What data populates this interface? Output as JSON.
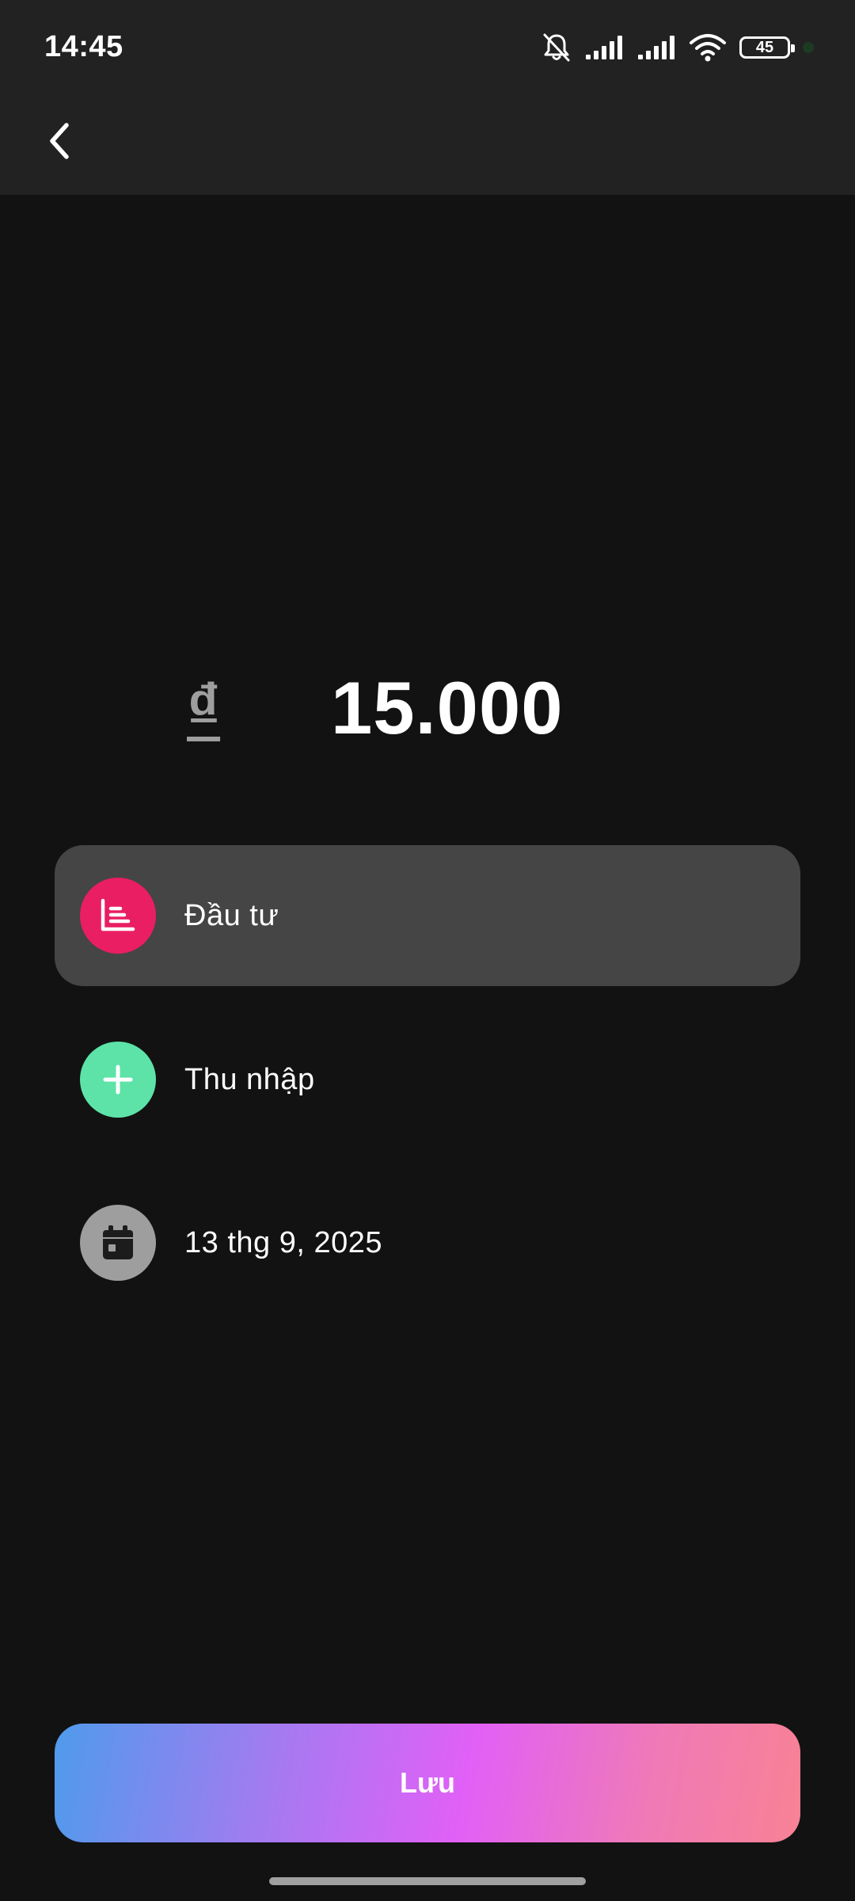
{
  "status_bar": {
    "time": "14:45",
    "battery_level": "45",
    "icons": [
      "bell-off-icon",
      "signal-icon",
      "signal-icon",
      "wifi-icon",
      "battery-icon"
    ]
  },
  "app_bar": {
    "back_icon": "chevron-left-icon"
  },
  "amount": {
    "currency_symbol": "₫",
    "value": "15.000"
  },
  "category": {
    "label": "Đầu tư",
    "icon": "chart-bars-icon",
    "color": "#e91e63"
  },
  "type": {
    "label": "Thu nhập",
    "icon": "plus-icon",
    "color": "#5de3a8"
  },
  "date": {
    "label": "13 thg 9, 2025",
    "icon": "calendar-icon",
    "color": "#9e9e9e"
  },
  "save_button": {
    "label": "Lưu"
  }
}
